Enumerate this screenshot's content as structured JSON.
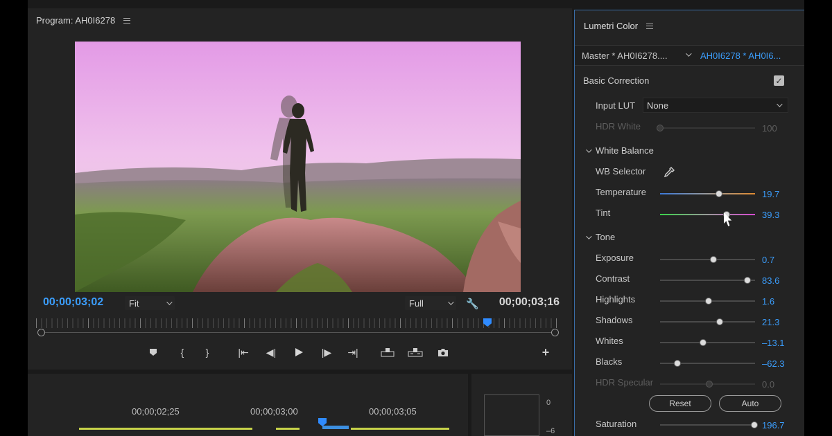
{
  "program": {
    "title": "Program: AH0I6278",
    "timecode_current": "00;00;03;02",
    "timecode_duration": "00;00;03;16",
    "fit_label": "Fit",
    "quality_label": "Full"
  },
  "timeline": {
    "labels": [
      "00;00;02;25",
      "00;00;03;00",
      "00;00;03;05"
    ],
    "meter_labels": [
      "0",
      "–6"
    ]
  },
  "lumetri": {
    "title": "Lumetri Color",
    "master_tab": "Master * AH0I6278....",
    "clip_tab": "AH0I6278 * AH0I6...",
    "basic_correction": "Basic Correction",
    "basic_correction_enabled": true,
    "input_lut_label": "Input LUT",
    "input_lut_value": "None",
    "hdr_white_label": "HDR White",
    "hdr_white_value": "100",
    "white_balance_title": "White Balance",
    "wb_selector_label": "WB Selector",
    "tone_title": "Tone",
    "rows": {
      "temperature": {
        "label": "Temperature",
        "value": "19.7"
      },
      "tint": {
        "label": "Tint",
        "value": "39.3"
      },
      "exposure": {
        "label": "Exposure",
        "value": "0.7"
      },
      "contrast": {
        "label": "Contrast",
        "value": "83.6"
      },
      "highlights": {
        "label": "Highlights",
        "value": "1.6"
      },
      "shadows": {
        "label": "Shadows",
        "value": "21.3"
      },
      "whites": {
        "label": "Whites",
        "value": "–13.1"
      },
      "blacks": {
        "label": "Blacks",
        "value": "–62.3"
      },
      "hdr_specular": {
        "label": "HDR Specular",
        "value": "0.0"
      },
      "saturation": {
        "label": "Saturation",
        "value": "196.7"
      }
    },
    "reset_label": "Reset",
    "auto_label": "Auto"
  },
  "colors": {
    "accent_blue": "#3b9dfb",
    "panel_bg": "#232323",
    "timeline_clip": "#c8d34a"
  }
}
